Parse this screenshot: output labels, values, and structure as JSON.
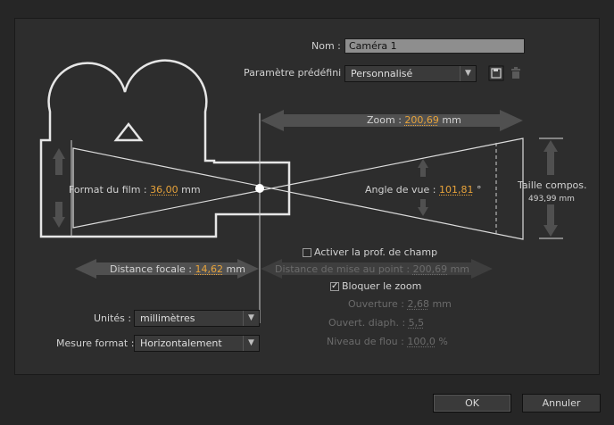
{
  "name": {
    "label": "Nom :",
    "value": "Caméra 1"
  },
  "preset": {
    "label": "Paramètre prédéfini :",
    "value": "Personnalisé"
  },
  "zoom": {
    "label": "Zoom :",
    "value": "200,69",
    "unit": "mm"
  },
  "film_format": {
    "label": "Format du film :",
    "value": "36,00",
    "unit": "mm"
  },
  "view_angle": {
    "label": "Angle de vue :",
    "value": "101,81",
    "unit": "°"
  },
  "comp_size": {
    "label1": "Taille",
    "label2": "compos.",
    "value": "493,99 mm"
  },
  "focal_distance": {
    "label": "Distance focale :",
    "value": "14,62",
    "unit": "mm"
  },
  "depth_of_field": {
    "label": "Activer la prof. de champ",
    "checked": false
  },
  "focus_distance": {
    "label": "Distance de mise au point :",
    "value": "200,69",
    "unit": "mm"
  },
  "lock_zoom": {
    "label": "Bloquer le zoom",
    "checked": true
  },
  "aperture": {
    "label": "Ouverture :",
    "value": "2,68",
    "unit": "mm"
  },
  "fstop": {
    "label": "Ouvert. diaph. :",
    "value": "5,5"
  },
  "blur": {
    "label": "Niveau de flou :",
    "value": "100,0",
    "unit": "%"
  },
  "units": {
    "label": "Unités :",
    "value": "millimètres"
  },
  "film_measure": {
    "label": "Mesure format :",
    "value": "Horizontalement"
  },
  "buttons": {
    "ok": "OK",
    "cancel": "Annuler"
  },
  "icons": {
    "save": "save-preset-icon",
    "delete": "trash-icon",
    "dropdown": "chevron-down-icon",
    "checkmark": "checkmark-icon"
  },
  "colors": {
    "accent_value": "#e8a33a",
    "diagram_line": "#e0e0e0",
    "arrow": "#505050",
    "panel": "#2d2d2d"
  }
}
